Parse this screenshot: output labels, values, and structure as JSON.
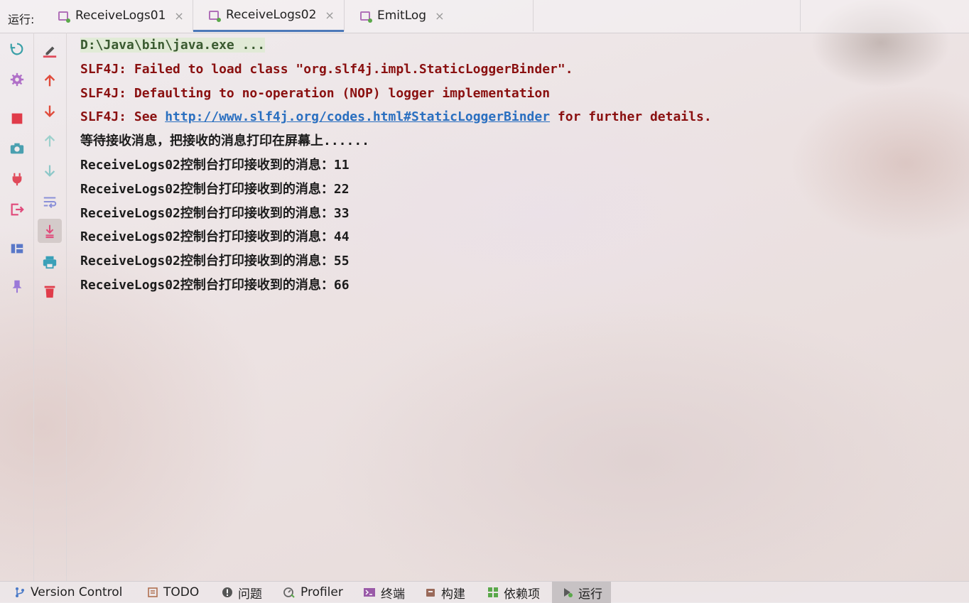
{
  "run_panel": {
    "label": "运行:",
    "tabs": [
      {
        "label": "ReceiveLogs01",
        "close": "×",
        "active": false
      },
      {
        "label": "ReceiveLogs02",
        "close": "×",
        "active": true
      },
      {
        "label": "EmitLog",
        "close": "×",
        "active": false
      }
    ]
  },
  "console": {
    "lines": [
      {
        "kind": "command",
        "text": "D:\\Java\\bin\\java.exe ..."
      },
      {
        "kind": "error",
        "text": "SLF4J: Failed to load class \"org.slf4j.impl.StaticLoggerBinder\"."
      },
      {
        "kind": "error",
        "text": "SLF4J: Defaulting to no-operation (NOP) logger implementation"
      },
      {
        "kind": "error",
        "prefix": "SLF4J: See ",
        "link": "http://www.slf4j.org/codes.html#StaticLoggerBinder",
        "suffix": " for further details."
      },
      {
        "kind": "output",
        "text": "等待接收消息，把接收的消息打印在屏幕上......"
      },
      {
        "kind": "output",
        "text": "ReceiveLogs02控制台打印接收到的消息：11"
      },
      {
        "kind": "output",
        "text": "ReceiveLogs02控制台打印接收到的消息：22"
      },
      {
        "kind": "output",
        "text": "ReceiveLogs02控制台打印接收到的消息：33"
      },
      {
        "kind": "output",
        "text": "ReceiveLogs02控制台打印接收到的消息：44"
      },
      {
        "kind": "output",
        "text": "ReceiveLogs02控制台打印接收到的消息：55"
      },
      {
        "kind": "output",
        "text": "ReceiveLogs02控制台打印接收到的消息：66"
      }
    ]
  },
  "left_toolbar": {
    "icons": [
      "rerun-icon",
      "settings-icon",
      "stop-icon",
      "camera-icon",
      "plug-icon",
      "exit-icon",
      "layout-icon",
      "pin-icon"
    ]
  },
  "console_toolbar": {
    "icons": [
      "clear-edit-icon",
      "up-arrow-icon",
      "down-arrow-icon",
      "prev-occurrence-icon",
      "next-occurrence-icon",
      "soft-wrap-icon",
      "scroll-to-end-icon",
      "print-icon",
      "trash-icon"
    ]
  },
  "bottom_bar": {
    "items": [
      {
        "label": "Version Control",
        "icon": "version-control-icon"
      },
      {
        "label": "TODO",
        "icon": "todo-icon"
      },
      {
        "label": "问题",
        "icon": "problems-icon"
      },
      {
        "label": "Profiler",
        "icon": "profiler-icon"
      },
      {
        "label": "终端",
        "icon": "terminal-icon"
      },
      {
        "label": "构建",
        "icon": "build-icon"
      },
      {
        "label": "依赖项",
        "icon": "dependencies-icon"
      },
      {
        "label": "运行",
        "icon": "run-icon",
        "active": true
      }
    ]
  },
  "colors": {
    "error_text": "#8a1010",
    "link": "#2a6fc0",
    "active_tab_underline": "#4c78b8",
    "icon_red": "#e04a5a",
    "icon_purple": "#b070b8"
  }
}
